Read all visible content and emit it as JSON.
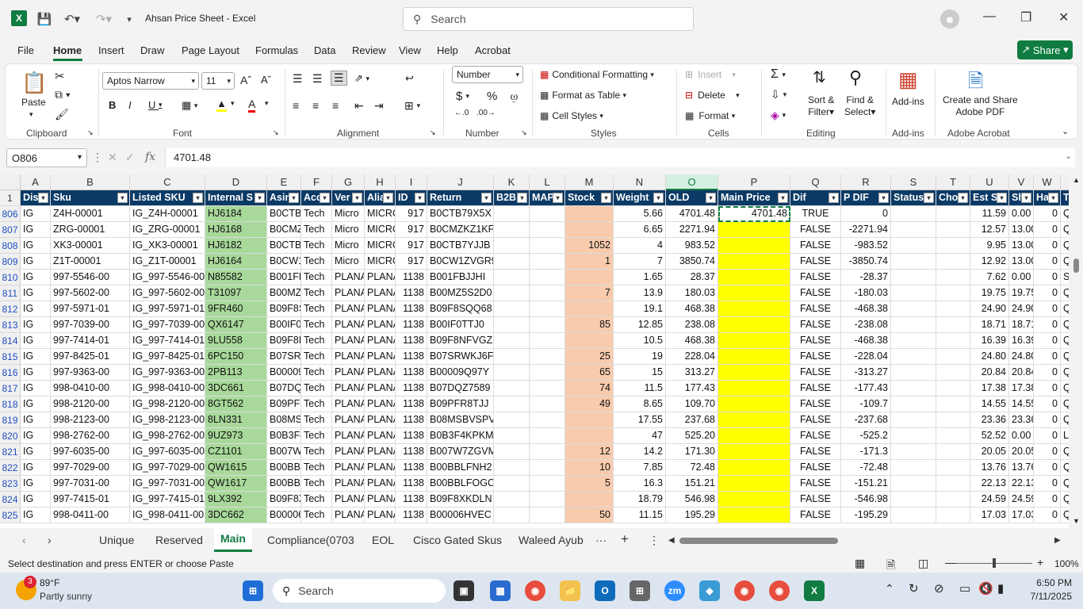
{
  "window": {
    "title": "Ahsan Price Sheet  -  Excel",
    "search_placeholder": "Search"
  },
  "menu": [
    "File",
    "Home",
    "Insert",
    "Draw",
    "Page Layout",
    "Formulas",
    "Data",
    "Review",
    "View",
    "Help",
    "Acrobat"
  ],
  "share_label": "Share",
  "ribbon": {
    "clipboard": {
      "paste": "Paste",
      "label": "Clipboard"
    },
    "font": {
      "name": "Aptos Narrow",
      "size": "11",
      "label": "Font"
    },
    "alignment": {
      "label": "Alignment"
    },
    "number": {
      "format": "Number",
      "label": "Number"
    },
    "styles": {
      "conditional": "Conditional Formatting",
      "format_table": "Format as Table",
      "cell_styles": "Cell Styles",
      "label": "Styles"
    },
    "cells": {
      "insert": "Insert",
      "delete": "Delete",
      "format": "Format",
      "label": "Cells"
    },
    "editing": {
      "sort": "Sort &",
      "sort2": "Filter",
      "find": "Find &",
      "find2": "Select",
      "label": "Editing"
    },
    "addins": {
      "btn": "Add-ins",
      "label": "Add-ins"
    },
    "acrobat": {
      "btn": "Create and Share",
      "btn2": "Adobe PDF",
      "label": "Adobe Acrobat"
    }
  },
  "formula_bar": {
    "name_box": "O806",
    "value": "4701.48"
  },
  "columns": [
    "A",
    "B",
    "C",
    "D",
    "E",
    "F",
    "G",
    "H",
    "I",
    "J",
    "K",
    "L",
    "M",
    "N",
    "O",
    "P",
    "Q",
    "R",
    "S",
    "T",
    "U",
    "V",
    "W",
    "X"
  ],
  "header_row": {
    "row_num": "1",
    "cells": [
      "Dis",
      "Sku",
      "Listed SKU",
      "Internal S",
      "Asin",
      "Acc",
      "Ver",
      "Alia",
      "ID",
      "Return",
      "B2B",
      "MAP",
      "Stock",
      "Weight",
      "OLD",
      "Main Price",
      "Dif",
      "P DIF",
      "Status",
      "Cho",
      "Est S",
      "Sh",
      "Ha",
      "T"
    ]
  },
  "rows": [
    {
      "n": "806",
      "v": [
        "IG",
        "Z4H-00001",
        "IG_Z4H-00001",
        "HJ6184",
        "B0CTB",
        "Tech",
        "Micro",
        "MICRO",
        "917",
        "B0CTB79X5X",
        "",
        "",
        "",
        "5.66",
        "4701.48",
        "4701.48",
        "TRUE",
        "0",
        "",
        "",
        "11.59",
        "0.00",
        "0",
        "Q"
      ]
    },
    {
      "n": "807",
      "v": [
        "IG",
        "ZRG-00001",
        "IG_ZRG-00001",
        "HJ6168",
        "B0CMZ",
        "Tech",
        "Micro",
        "MICRO",
        "917",
        "B0CMZKZ1KF",
        "",
        "",
        "",
        "6.65",
        "2271.94",
        "",
        "FALSE",
        "-2271.94",
        "",
        "",
        "12.57",
        "13.00",
        "0",
        "Q"
      ]
    },
    {
      "n": "808",
      "v": [
        "IG",
        "XK3-00001",
        "IG_XK3-00001",
        "HJ6182",
        "B0CTB",
        "Tech",
        "Micro",
        "MICRO",
        "917",
        "B0CTB7YJJB",
        "",
        "",
        "1052",
        "4",
        "983.52",
        "",
        "FALSE",
        "-983.52",
        "",
        "",
        "9.95",
        "13.00",
        "0",
        "Q"
      ]
    },
    {
      "n": "809",
      "v": [
        "IG",
        "Z1T-00001",
        "IG_Z1T-00001",
        "HJ6164",
        "B0CW1",
        "Tech",
        "Micro",
        "MICRO",
        "917",
        "B0CW1ZVGR9",
        "",
        "",
        "1",
        "7",
        "3850.74",
        "",
        "FALSE",
        "-3850.74",
        "",
        "",
        "12.92",
        "13.00",
        "0",
        "Q"
      ]
    },
    {
      "n": "810",
      "v": [
        "IG",
        "997-5546-00",
        "IG_997-5546-00",
        "N85582",
        "B001FE",
        "Tech",
        "PLANA",
        "PLANA",
        "1138",
        "B001FBJJHI",
        "",
        "",
        "",
        "1.65",
        "28.37",
        "",
        "FALSE",
        "-28.37",
        "",
        "",
        "7.62",
        "0.00",
        "0",
        "S"
      ]
    },
    {
      "n": "811",
      "v": [
        "IG",
        "997-5602-00",
        "IG_997-5602-00",
        "T31097",
        "B00MZ",
        "Tech",
        "PLANA",
        "PLANA",
        "1138",
        "B00MZ5S2D0",
        "",
        "",
        "7",
        "13.9",
        "180.03",
        "",
        "FALSE",
        "-180.03",
        "",
        "",
        "19.75",
        "19.75",
        "0",
        "Q"
      ]
    },
    {
      "n": "812",
      "v": [
        "IG",
        "997-5971-01",
        "IG_997-5971-01",
        "9FR460",
        "B09F8S",
        "Tech",
        "PLANA",
        "PLANA",
        "1138",
        "B09F8SQQ68",
        "",
        "",
        "",
        "19.1",
        "468.38",
        "",
        "FALSE",
        "-468.38",
        "",
        "",
        "24.90",
        "24.90",
        "0",
        "Q"
      ]
    },
    {
      "n": "813",
      "v": [
        "IG",
        "997-7039-00",
        "IG_997-7039-00",
        "QX6147",
        "B00IF0",
        "Tech",
        "PLANA",
        "PLANA",
        "1138",
        "B00IF0TTJ0",
        "",
        "",
        "85",
        "12.85",
        "238.08",
        "",
        "FALSE",
        "-238.08",
        "",
        "",
        "18.71",
        "18.71",
        "0",
        "Q"
      ]
    },
    {
      "n": "814",
      "v": [
        "IG",
        "997-7414-01",
        "IG_997-7414-01",
        "9LU558",
        "B09F8N",
        "Tech",
        "PLANA",
        "PLANA",
        "1138",
        "B09F8NFVGZ",
        "",
        "",
        "",
        "10.5",
        "468.38",
        "",
        "FALSE",
        "-468.38",
        "",
        "",
        "16.39",
        "16.39",
        "0",
        "Q"
      ]
    },
    {
      "n": "815",
      "v": [
        "IG",
        "997-8425-01",
        "IG_997-8425-01",
        "6PC150",
        "B07SRV",
        "Tech",
        "PLANA",
        "PLANA",
        "1138",
        "B07SRWKJ6F",
        "",
        "",
        "25",
        "19",
        "228.04",
        "",
        "FALSE",
        "-228.04",
        "",
        "",
        "24.80",
        "24.80",
        "0",
        "Q"
      ]
    },
    {
      "n": "816",
      "v": [
        "IG",
        "997-9363-00",
        "IG_997-9363-00",
        "2PB113",
        "B00009",
        "Tech",
        "PLANA",
        "PLANA",
        "1138",
        "B00009Q97Y",
        "",
        "",
        "65",
        "15",
        "313.27",
        "",
        "FALSE",
        "-313.27",
        "",
        "",
        "20.84",
        "20.84",
        "0",
        "Q"
      ]
    },
    {
      "n": "817",
      "v": [
        "IG",
        "998-0410-00",
        "IG_998-0410-00",
        "3DC661",
        "B07DQ",
        "Tech",
        "PLANA",
        "PLANA",
        "1138",
        "B07DQZ7589",
        "",
        "",
        "74",
        "11.5",
        "177.43",
        "",
        "FALSE",
        "-177.43",
        "",
        "",
        "17.38",
        "17.38",
        "0",
        "Q"
      ]
    },
    {
      "n": "818",
      "v": [
        "IG",
        "998-2120-00",
        "IG_998-2120-00",
        "8GT562",
        "B09PFF",
        "Tech",
        "PLANA",
        "PLANA",
        "1138",
        "B09PFR8TJJ",
        "",
        "",
        "49",
        "8.65",
        "109.70",
        "",
        "FALSE",
        "-109.7",
        "",
        "",
        "14.55",
        "14.55",
        "0",
        "Q"
      ]
    },
    {
      "n": "819",
      "v": [
        "IG",
        "998-2123-00",
        "IG_998-2123-00",
        "8LN331",
        "B08MS",
        "Tech",
        "PLANA",
        "PLANA",
        "1138",
        "B08MSBVSPV",
        "",
        "",
        "",
        "17.55",
        "237.68",
        "",
        "FALSE",
        "-237.68",
        "",
        "",
        "23.36",
        "23.36",
        "0",
        "Q"
      ]
    },
    {
      "n": "820",
      "v": [
        "IG",
        "998-2762-00",
        "IG_998-2762-00",
        "9UZ973",
        "B0B3F4",
        "Tech",
        "PLANA",
        "PLANA",
        "1138",
        "B0B3F4KPKM",
        "",
        "",
        "",
        "47",
        "525.20",
        "",
        "FALSE",
        "-525.2",
        "",
        "",
        "52.52",
        "0.00",
        "0",
        "L"
      ]
    },
    {
      "n": "821",
      "v": [
        "IG",
        "997-6035-00",
        "IG_997-6035-00",
        "CZ1101",
        "B007W",
        "Tech",
        "PLANA",
        "PLANA",
        "1138",
        "B007W7ZGVM",
        "",
        "",
        "12",
        "14.2",
        "171.30",
        "",
        "FALSE",
        "-171.3",
        "",
        "",
        "20.05",
        "20.05",
        "0",
        "Q"
      ]
    },
    {
      "n": "822",
      "v": [
        "IG",
        "997-7029-00",
        "IG_997-7029-00",
        "QW1615",
        "B00BBI",
        "Tech",
        "PLANA",
        "PLANA",
        "1138",
        "B00BBLFNH2",
        "",
        "",
        "10",
        "7.85",
        "72.48",
        "",
        "FALSE",
        "-72.48",
        "",
        "",
        "13.76",
        "13.76",
        "0",
        "Q"
      ]
    },
    {
      "n": "823",
      "v": [
        "IG",
        "997-7031-00",
        "IG_997-7031-00",
        "QW1617",
        "B00BBI",
        "Tech",
        "PLANA",
        "PLANA",
        "1138",
        "B00BBLFOGC",
        "",
        "",
        "5",
        "16.3",
        "151.21",
        "",
        "FALSE",
        "-151.21",
        "",
        "",
        "22.13",
        "22.13",
        "0",
        "Q"
      ]
    },
    {
      "n": "824",
      "v": [
        "IG",
        "997-7415-01",
        "IG_997-7415-01",
        "9LX392",
        "B09F8X",
        "Tech",
        "PLANA",
        "PLANA",
        "1138",
        "B09F8XKDLN",
        "",
        "",
        "",
        "18.79",
        "546.98",
        "",
        "FALSE",
        "-546.98",
        "",
        "",
        "24.59",
        "24.59",
        "0",
        "Q"
      ]
    },
    {
      "n": "825",
      "v": [
        "IG",
        "998-0411-00",
        "IG_998-0411-00",
        "3DC662",
        "B00006",
        "Tech",
        "PLANA",
        "PLANA",
        "1138",
        "B00006HVEC",
        "",
        "",
        "50",
        "11.15",
        "195.29",
        "",
        "FALSE",
        "-195.29",
        "",
        "",
        "17.03",
        "17.03",
        "0",
        "Q"
      ]
    }
  ],
  "sheet_tabs": [
    "Unique",
    "Reserved",
    "Main",
    "Compliance(0703",
    "EOL",
    "Cisco Gated Skus",
    "Waleed Ayub"
  ],
  "active_tab": "Main",
  "status": {
    "message": "Select destination and press ENTER or choose Paste",
    "zoom": "100%"
  },
  "taskbar": {
    "temp": "89°F",
    "weather": "Partly sunny",
    "badge": "3",
    "search": "Search",
    "time": "6:50 PM",
    "date": "7/11/2025"
  }
}
